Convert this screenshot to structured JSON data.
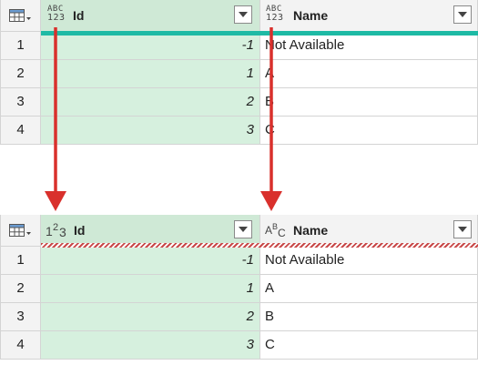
{
  "before": {
    "columns": [
      {
        "type_icon": "abc-123-icon",
        "type_top": "ABC",
        "type_bottom": "123",
        "label": "Id"
      },
      {
        "type_icon": "abc-123-icon",
        "type_top": "ABC",
        "type_bottom": "123",
        "label": "Name"
      }
    ],
    "rows": [
      {
        "num": "1",
        "id": "-1",
        "name": "Not Available"
      },
      {
        "num": "2",
        "id": "1",
        "name": "A"
      },
      {
        "num": "3",
        "id": "2",
        "name": "B"
      },
      {
        "num": "4",
        "id": "3",
        "name": "C"
      }
    ],
    "quality_bar": "valid"
  },
  "after": {
    "columns": [
      {
        "type_icon": "whole-number-icon",
        "label": "Id"
      },
      {
        "type_icon": "text-type-icon",
        "label": "Name"
      }
    ],
    "rows": [
      {
        "num": "1",
        "id": "-1",
        "name": "Not Available"
      },
      {
        "num": "2",
        "id": "1",
        "name": "A"
      },
      {
        "num": "3",
        "id": "2",
        "name": "B"
      },
      {
        "num": "4",
        "id": "3",
        "name": "C"
      }
    ],
    "quality_bar": "pending"
  },
  "colors": {
    "id_header": "#cfe9d6",
    "id_cells": "#d6f0de",
    "valid_bar": "#1ebaa5",
    "pending_bar": "#c84848",
    "arrow": "#d9302c"
  }
}
